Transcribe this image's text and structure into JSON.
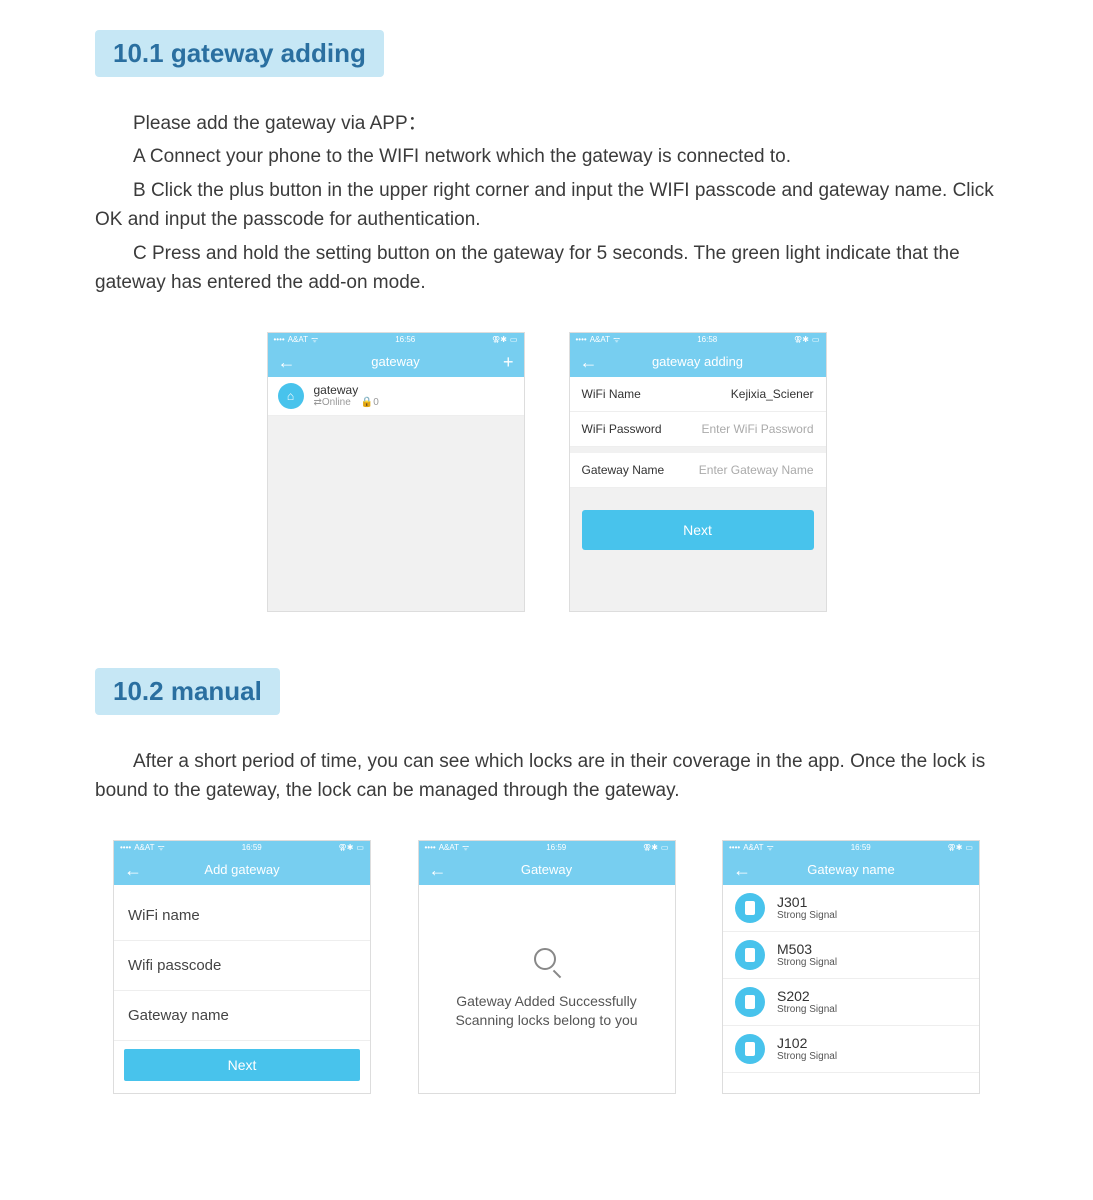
{
  "section101": {
    "title": "10.1 gateway adding",
    "p_intro": "Please add the gateway via APP：",
    "p_a": "A Connect your phone to the WIFI network which the gateway is connected to.",
    "p_b": "B Click the plus button in the upper right corner and input the WIFI passcode and gateway name. Click OK and input the passcode for authentication.",
    "p_c": "C Press and hold the setting button on the gateway for 5 seconds. The green light indicate that the gateway has entered the add-on mode."
  },
  "section102": {
    "title": "10.2 manual",
    "p": "After a short period of time, you can see which locks are in their coverage in the app. Once the lock is bound to the gateway, the lock can be managed through the gateway."
  },
  "status": {
    "carrier": "A&AT",
    "time1": "16:56",
    "time2": "16:58",
    "time3": "16:59"
  },
  "screenA": {
    "title": "gateway",
    "item_name": "gateway",
    "item_status": "Online",
    "item_count": "0"
  },
  "screenB": {
    "title": "gateway adding",
    "wifi_name_label": "WiFi Name",
    "wifi_name_value": "Kejixia_Sciener",
    "wifi_pw_label": "WiFi Password",
    "wifi_pw_placeholder": "Enter WiFi Password",
    "gw_name_label": "Gateway Name",
    "gw_name_placeholder": "Enter Gateway Name",
    "next": "Next"
  },
  "screenC": {
    "title": "Add gateway",
    "wifi_name": "WiFi name",
    "wifi_passcode": "Wifi passcode",
    "gateway_name": "Gateway name",
    "next": "Next"
  },
  "screenD": {
    "title": "Gateway",
    "line1": "Gateway Added Successfully",
    "line2": "Scanning locks belong to you"
  },
  "screenE": {
    "title": "Gateway name",
    "locks": [
      {
        "name": "J301",
        "signal": "Strong Signal"
      },
      {
        "name": "M503",
        "signal": "Strong Signal"
      },
      {
        "name": "S202",
        "signal": "Strong Signal"
      },
      {
        "name": "J102",
        "signal": "Strong Signal"
      }
    ]
  }
}
